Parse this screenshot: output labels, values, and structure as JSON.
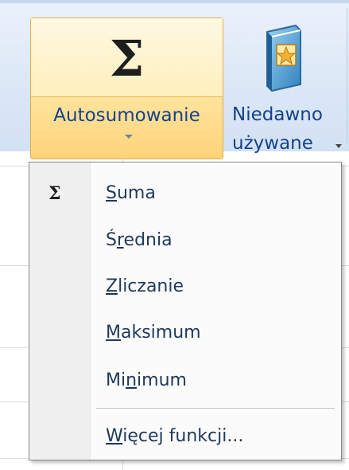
{
  "ribbon": {
    "autosum": {
      "icon": "sigma-icon",
      "label": "Autosumowanie",
      "accent": "#ffd37a"
    },
    "recent": {
      "icon": "book-star-icon",
      "label_line1": "Niedawno",
      "label_line2": "używane"
    }
  },
  "menu": {
    "items": [
      {
        "pre": "",
        "underline": "S",
        "post": "uma",
        "icon": "sigma-icon"
      },
      {
        "pre": "Ś",
        "underline": "r",
        "post": "ednia"
      },
      {
        "pre": "",
        "underline": "Z",
        "post": "liczanie"
      },
      {
        "pre": "",
        "underline": "M",
        "post": "aksimum"
      },
      {
        "pre": "Mi",
        "underline": "n",
        "post": "imum"
      },
      {
        "pre": "",
        "underline": "W",
        "post": "ięcej funkcji..."
      }
    ]
  },
  "colors": {
    "label_text": "#15428b",
    "menu_text": "#1e395b"
  }
}
